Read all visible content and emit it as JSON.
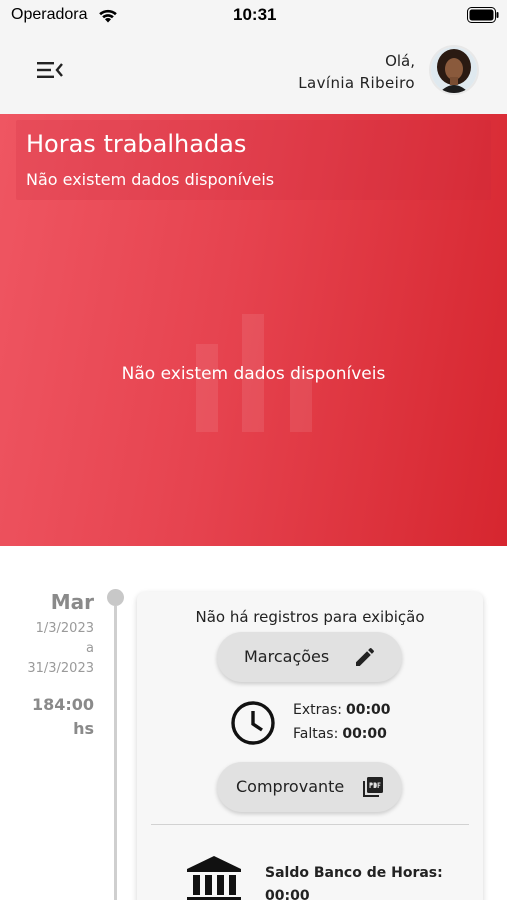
{
  "status_bar": {
    "carrier": "Operadora",
    "time": "10:31"
  },
  "header": {
    "greeting": "Olá,",
    "user_name": "Lavínia Ribeiro",
    "menu_icon": "menu-collapse-icon",
    "avatar": "user-avatar"
  },
  "hero": {
    "title": "Horas trabalhadas",
    "subtitle": "Não existem dados disponíveis",
    "empty_message": "Não existem dados disponíveis",
    "placeholder_icon": "bar-chart-icon",
    "gradient_colors": [
      "#ef5662",
      "#d6262f"
    ]
  },
  "timeline": {
    "month": "Mar",
    "date_from": "1/3/2023",
    "date_separator": "a",
    "date_to": "31/3/2023",
    "hours_value": "184:00",
    "hours_unit": "hs"
  },
  "record": {
    "empty_message": "Não há registros para exibição",
    "marcacoes_label": "Marcações",
    "marcacoes_icon": "pencil-icon",
    "comprovante_label": "Comprovante",
    "comprovante_icon": "pdf-icon",
    "clock_icon": "clock-icon",
    "extras_label": "Extras:",
    "extras_value": "00:00",
    "faltas_label": "Faltas:",
    "faltas_value": "00:00",
    "bank_icon": "bank-icon",
    "bank_label": "Saldo Banco de Horas:",
    "bank_value": "00:00"
  }
}
